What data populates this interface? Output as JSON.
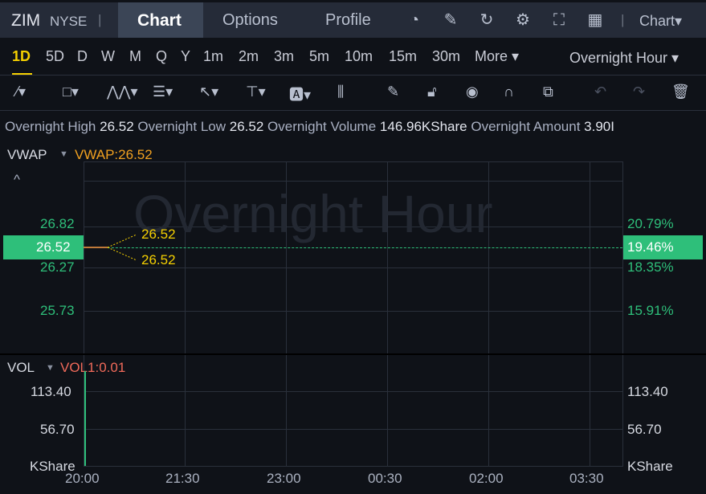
{
  "header": {
    "symbol": "ZIM",
    "exchange": "NYSE",
    "tabs": [
      "Chart",
      "Options",
      "Profile"
    ],
    "chart_menu": "Chart▾"
  },
  "periods": {
    "items": [
      "1D",
      "5D",
      "D",
      "W",
      "M",
      "Q",
      "Y",
      "1m",
      "2m",
      "3m",
      "5m",
      "10m",
      "15m",
      "30m",
      "More ▾"
    ],
    "active": "1D",
    "session": "Overnight Hour ▾"
  },
  "stats": [
    {
      "label": "Overnight High",
      "value": "26.52"
    },
    {
      "label": "Overnight Low",
      "value": "26.52"
    },
    {
      "label": "Overnight Volume",
      "value": "146.96KShare"
    },
    {
      "label": "Overnight Amount",
      "value": "3.90I"
    }
  ],
  "main": {
    "indicator": "VWAP",
    "indicator_value": "VWAP:26.52",
    "watermark": "Overnight Hour",
    "y_left": [
      "26.82",
      "26.27",
      "25.73"
    ],
    "y_right": [
      "20.79%",
      "18.35%",
      "15.91%"
    ],
    "current_price": "26.52",
    "current_pct": "19.46%",
    "callout_high": "26.52",
    "callout_low": "26.52",
    "collapse": "^"
  },
  "volume": {
    "indicator": "VOL",
    "indicator_value": "VOL1:0.01",
    "y_left": [
      "113.40",
      "56.70",
      "KShare"
    ],
    "y_right": [
      "113.40",
      "56.70",
      "KShare"
    ]
  },
  "x_axis": [
    "20:00",
    "21:30",
    "23:00",
    "00:30",
    "02:00",
    "03:30"
  ],
  "colors": {
    "up": "#2ebf7a",
    "accent": "#f5d000",
    "vwap": "#f0a020",
    "vol": "#f06a5a"
  }
}
